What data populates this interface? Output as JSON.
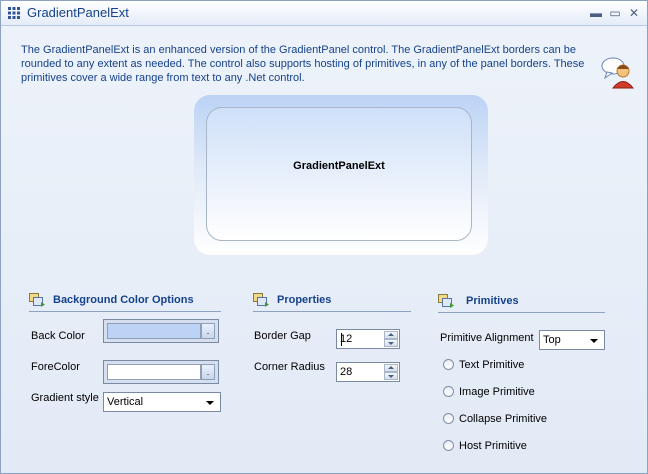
{
  "window": {
    "title": "GradientPanelExt",
    "minimize_glyph": "▬",
    "maximize_glyph": "▭",
    "close_glyph": "✕"
  },
  "description": "The GradientPanelExt is an enhanced version of the GradientPanel control. The GradientPanelExt borders can be rounded to any extent as needed. The control also supports hosting of primitives, in any of the panel borders. These primitives cover a wide range from text to any .Net control.",
  "demo_panel": {
    "text": "GradientPanelExt"
  },
  "background_options": {
    "title": "Background Color Options",
    "back_color_label": "Back Color",
    "back_color_value": "#bcd3f5",
    "fore_color_label": "ForeColor",
    "fore_color_value": "#ffffff",
    "picker_glyph": ".",
    "gradient_style_label": "Gradient style",
    "gradient_style_value": "Vertical"
  },
  "properties": {
    "title": "Properties",
    "border_gap_label": "Border Gap",
    "border_gap_value": "12",
    "corner_radius_label": "Corner Radius",
    "corner_radius_value": "28"
  },
  "primitives": {
    "title": "Primitives",
    "alignment_label": "Primitive Alignment",
    "alignment_value": "Top",
    "options": [
      "Text Primitive",
      "Image Primitive",
      "Collapse Primitive",
      "Host Primitive"
    ]
  },
  "colors": {
    "title_text": "#15428b",
    "accent": "#8da2c2"
  }
}
